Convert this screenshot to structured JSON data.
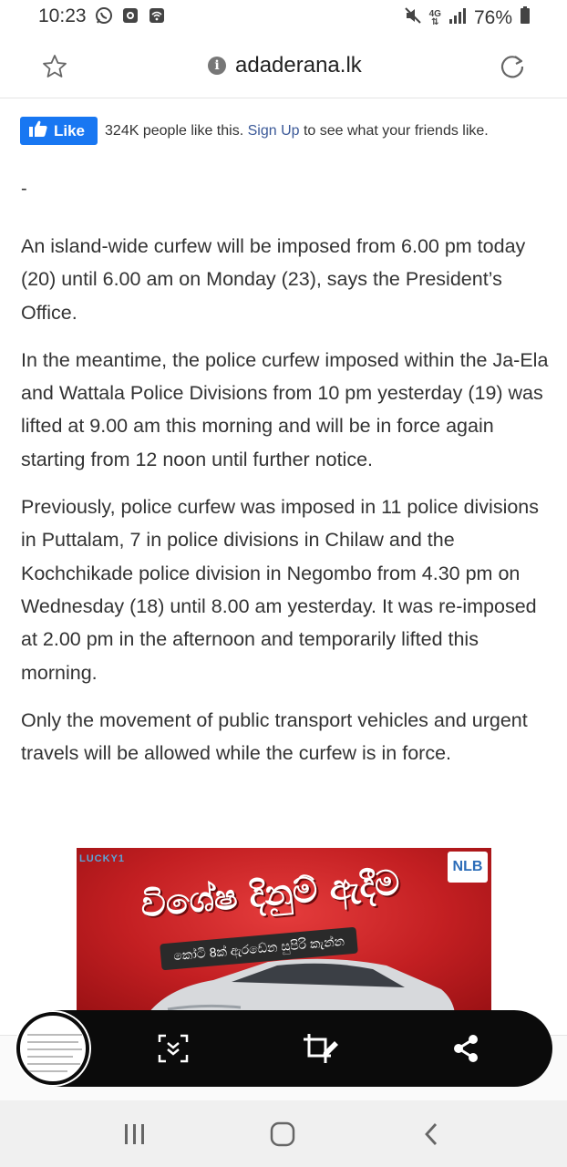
{
  "status_bar": {
    "time": "10:23",
    "network": "4G",
    "battery": "76%",
    "icons_left": [
      "whatsapp-icon",
      "screen-record-icon",
      "wifi-calling-icon"
    ],
    "icons_right": [
      "mute-icon",
      "network-4g-icon",
      "signal-icon",
      "battery-icon"
    ]
  },
  "browser": {
    "url": "adaderana.lk"
  },
  "facebook": {
    "like_label": "Like",
    "count_text": "324K people like this.",
    "signup_label": "Sign Up",
    "suffix_text": "to see what your friends like."
  },
  "article": {
    "separator": "-",
    "paragraphs": [
      "An island-wide curfew will be imposed from 6.00 pm today (20) until 6.00 am on Monday (23), says the President’s Office.",
      "In the meantime, the police curfew imposed within the Ja-Ela and Wattala Police Divisions from 10 pm yesterday (19) was lifted at 9.00 am this morning and will be in force again starting from 12 noon until further notice.",
      "Previously, police curfew was imposed in 11 police divisions in Puttalam, 7 in police divisions in Chilaw and the Kochchikade police division in Negombo from 4.30 pm on Wednesday (18) until 8.00 am yesterday. It was re-imposed at 2.00 pm in the afternoon and temporarily lifted this morning.",
      "Only the movement of public transport vehicles and urgent travels will be allowed while the curfew is in force."
    ]
  },
  "ad": {
    "brand_left": "LUCKY1",
    "brand_right": "NLB",
    "title": "විශේෂ දිනුම් ඇදීම",
    "subtitle": "කෝටි 8ක් ඇරඩේන සුපිරි කැන්න",
    "colors": {
      "background": "#c31f22"
    }
  },
  "capture_toolbar": {
    "buttons": [
      "scroll-capture-icon",
      "crop-edit-icon",
      "share-icon"
    ]
  },
  "nav_bar": {
    "buttons": [
      "recent-apps-icon",
      "home-icon",
      "back-icon"
    ]
  },
  "colors": {
    "facebook": "#1877f2",
    "link": "#3b5998"
  }
}
